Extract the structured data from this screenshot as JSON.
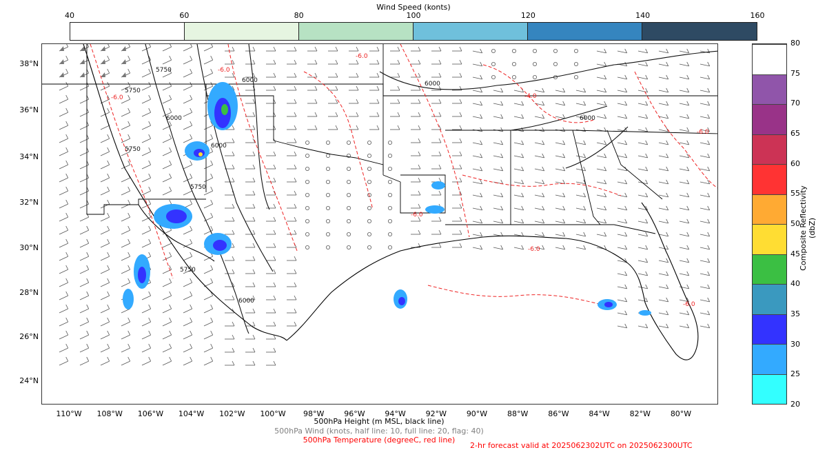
{
  "wind_colorbar": {
    "title": "Wind Speed (konts)",
    "ticks": [
      "40",
      "60",
      "80",
      "100",
      "120",
      "140",
      "160"
    ],
    "colors": [
      "#ffffff",
      "#e6f5e1",
      "#b7e2c3",
      "#6fc0dc",
      "#3585bf",
      "#2e4a63"
    ]
  },
  "map": {
    "lat_labels": [
      "38°N",
      "36°N",
      "34°N",
      "32°N",
      "30°N",
      "28°N",
      "26°N",
      "24°N"
    ],
    "lon_labels": [
      "110°W",
      "108°W",
      "106°W",
      "104°W",
      "102°W",
      "100°W",
      "98°W",
      "96°W",
      "94°W",
      "92°W",
      "90°W",
      "88°W",
      "86°W",
      "84°W",
      "82°W",
      "80°W"
    ],
    "contour_labels": [
      "5750",
      "5750",
      "6000",
      "6000",
      "6000",
      "6000",
      "5750",
      "5750",
      "5750",
      "6000",
      "6000"
    ],
    "temp_labels": [
      "-6.0",
      "-6.0",
      "-4.0",
      "-6.0",
      "-6.0",
      "-6.0",
      "-6.0",
      "-6.0"
    ]
  },
  "reflectivity_colorbar": {
    "title": "Composite Reflectivity (dbZ)",
    "ticks": [
      "20",
      "25",
      "30",
      "35",
      "40",
      "45",
      "50",
      "55",
      "60",
      "65",
      "70",
      "75",
      "80"
    ],
    "colors": [
      "#33ffff",
      "#33aaff",
      "#3333ff",
      "#3a99bf",
      "#3bbf43",
      "#ffdd33",
      "#ffaa33",
      "#ff3333",
      "#cc3355",
      "#993388",
      "#9055aa",
      "#ffffff"
    ]
  },
  "captions": {
    "height": "500hPa Height (m MSL, black line)",
    "wind": "500hPa Wind (knots, half line: 10, full line: 20, flag: 40)",
    "temperature": "500hPa Temperature (degreeC, red line)",
    "valid": "2-hr forecast valid at 2025062302UTC on 2025062300UTC"
  }
}
